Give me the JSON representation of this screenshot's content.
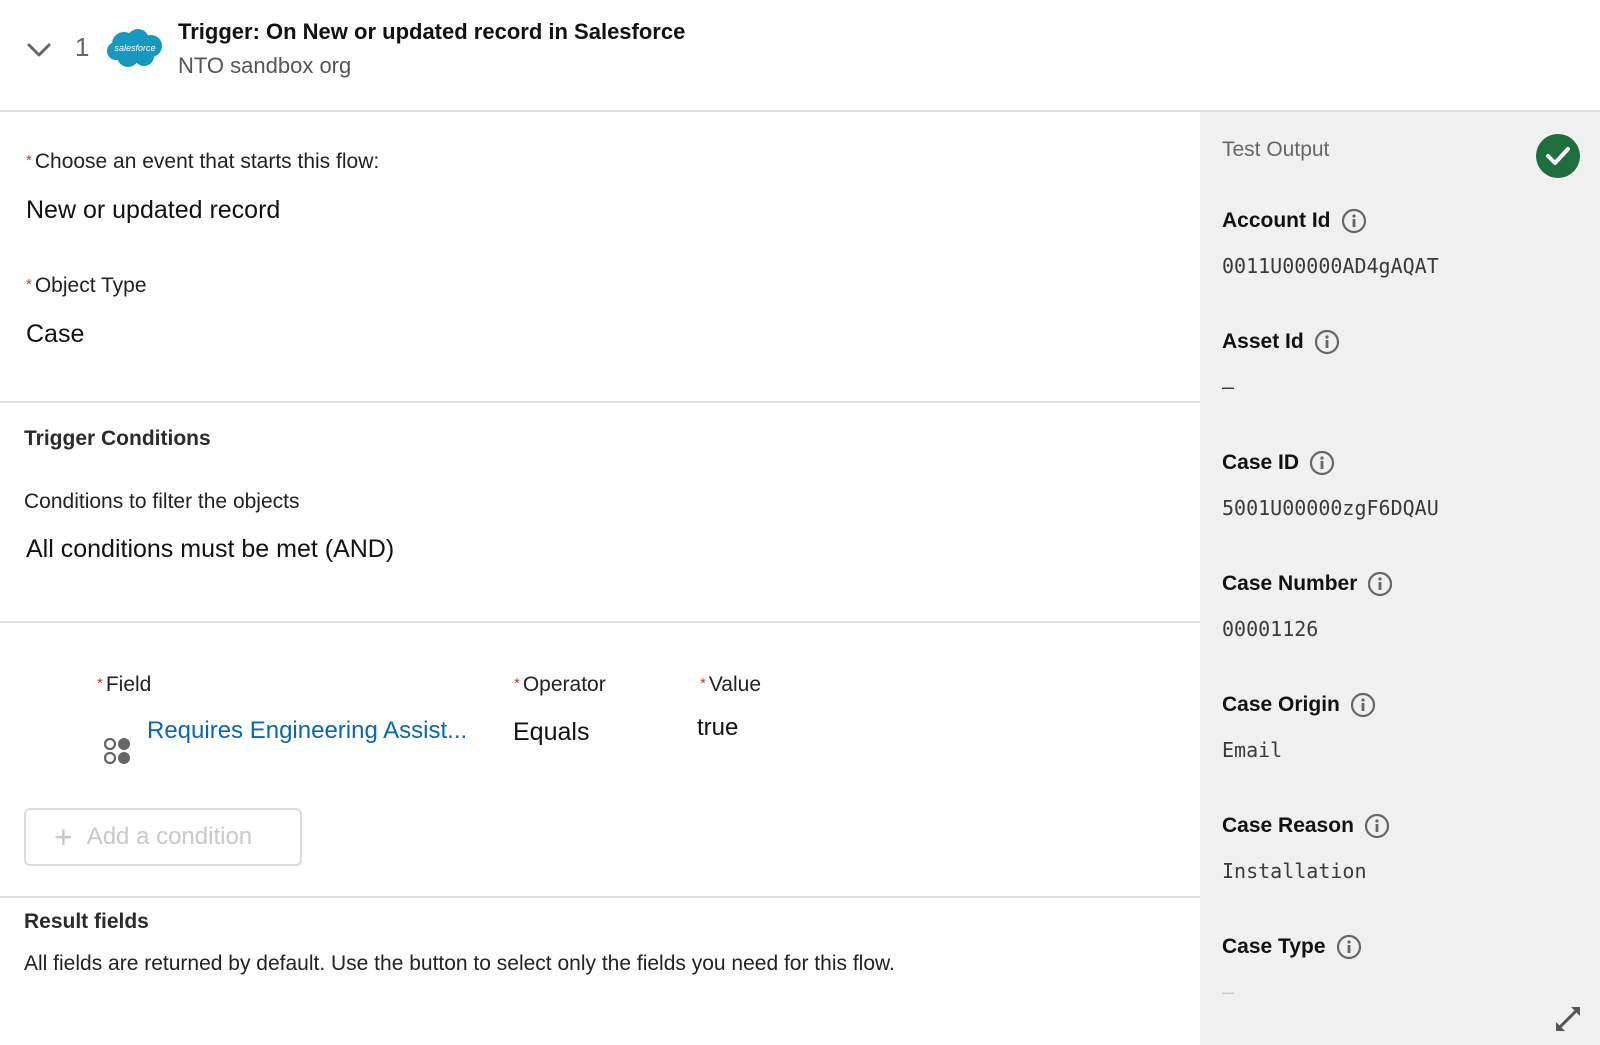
{
  "header": {
    "step_number": "1",
    "title": "Trigger: On New or updated record in Salesforce",
    "subtitle": "NTO sandbox org",
    "logo_text": "salesforce"
  },
  "trigger": {
    "event_label": "Choose an event that starts this flow:",
    "event_value": "New or updated record",
    "object_type_label": "Object Type",
    "object_type_value": "Case",
    "required_marker": "*"
  },
  "conditions": {
    "section_title": "Trigger Conditions",
    "filter_label": "Conditions to filter the objects",
    "filter_value": "All conditions must be met (AND)",
    "columns": {
      "field": "Field",
      "operator": "Operator",
      "value": "Value"
    },
    "rows": [
      {
        "field": "Requires Engineering Assist...",
        "operator": "Equals",
        "value": "true"
      }
    ],
    "add_button_label": "Add a condition"
  },
  "result_fields": {
    "title": "Result fields",
    "description": "All fields are returned by default. Use the button to select only the fields you need for this flow."
  },
  "test_output": {
    "title": "Test Output",
    "status": "success",
    "items": [
      {
        "label": "Account Id",
        "value": "0011U00000AD4gAQAT"
      },
      {
        "label": "Asset Id",
        "value": "–"
      },
      {
        "label": "Case ID",
        "value": "5001U00000zgF6DQAU"
      },
      {
        "label": "Case Number",
        "value": "00001126"
      },
      {
        "label": "Case Origin",
        "value": "Email"
      },
      {
        "label": "Case Reason",
        "value": "Installation"
      },
      {
        "label": "Case Type",
        "value": "–"
      }
    ]
  },
  "colors": {
    "brand_blue": "#1798c1",
    "link_blue": "#0b66b8",
    "required_red": "#c23934",
    "success_green": "#1f6e3e",
    "panel_bg": "#f0f0f0"
  }
}
